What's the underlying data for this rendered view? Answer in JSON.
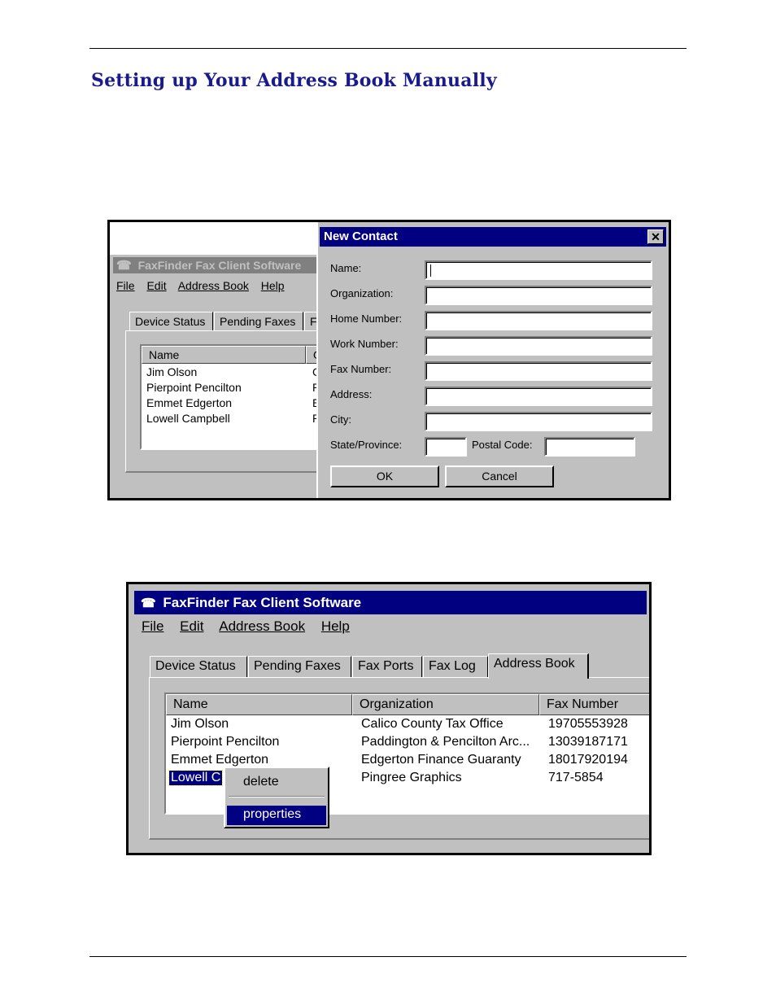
{
  "page": {
    "heading": "Setting up Your Address Book Manually"
  },
  "shot1": {
    "app_title": "FaxFinder Fax Client Software",
    "menu": [
      "File",
      "Edit",
      "Address Book",
      "Help"
    ],
    "tabs": [
      "Device Status",
      "Pending Faxes",
      "F"
    ],
    "columns": [
      "Name",
      "O"
    ],
    "rows": [
      {
        "name": "Jim Olson",
        "org": "C"
      },
      {
        "name": "Pierpoint Pencilton",
        "org": "P"
      },
      {
        "name": "Emmet Edgerton",
        "org": "E"
      },
      {
        "name": "Lowell Campbell",
        "org": "P"
      }
    ],
    "dialog": {
      "title": "New Contact",
      "close_glyph": "✕",
      "labels": {
        "name": "Name:",
        "organization": "Organization:",
        "home": "Home Number:",
        "work": "Work Number:",
        "fax": "Fax Number:",
        "address": "Address:",
        "city": "City:",
        "state": "State/Province:",
        "postal": "Postal Code:"
      },
      "values": {
        "name": "",
        "organization": "",
        "home": "",
        "work": "",
        "fax": "",
        "address": "",
        "city": "",
        "state": "",
        "postal": ""
      },
      "ok_label": "OK",
      "cancel_label": "Cancel"
    }
  },
  "shot2": {
    "app_title": "FaxFinder Fax Client Software",
    "menu": [
      "File",
      "Edit",
      "Address Book",
      "Help"
    ],
    "tabs": [
      "Device Status",
      "Pending Faxes",
      "Fax Ports",
      "Fax Log",
      "Address Book"
    ],
    "active_tab": "Address Book",
    "columns": [
      "Name",
      "Organization",
      "Fax Number"
    ],
    "rows": [
      {
        "name": "Jim Olson",
        "org": "Calico County Tax Office",
        "fax": "19705553928"
      },
      {
        "name": "Pierpoint Pencilton",
        "org": "Paddington & Pencilton Arc...",
        "fax": "13039187171"
      },
      {
        "name": "Emmet Edgerton",
        "org": "Edgerton Finance Guaranty",
        "fax": "18017920194"
      },
      {
        "name": "Lowell C",
        "org": "Pingree Graphics",
        "fax": "717-5854"
      }
    ],
    "context_menu": [
      "delete",
      "properties"
    ],
    "highlighted_item": "properties"
  },
  "icons": {
    "app": "fax-machine-icon",
    "close": "close-icon"
  },
  "colors": {
    "heading": "#1a1a8c",
    "titlebar_active": "#000080",
    "titlebar_inactive": "#808080",
    "window_face": "#c0c0c0"
  }
}
